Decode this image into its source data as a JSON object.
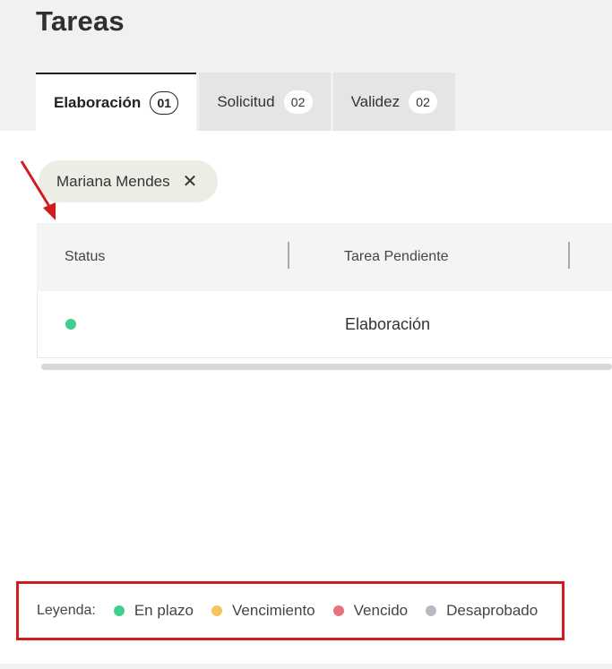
{
  "page": {
    "title": "Tareas"
  },
  "tabs": [
    {
      "label": "Elaboración",
      "count": "01",
      "active": true
    },
    {
      "label": "Solicitud",
      "count": "02",
      "active": false
    },
    {
      "label": "Validez",
      "count": "02",
      "active": false
    }
  ],
  "filter_chip": {
    "label": "Mariana Mendes",
    "close_glyph": "✕"
  },
  "table": {
    "columns": [
      "Status",
      "Tarea Pendiente"
    ],
    "rows": [
      {
        "status": "En plazo",
        "status_color": "#3ecf8e",
        "task": "Elaboración"
      }
    ]
  },
  "legend": {
    "label": "Leyenda:",
    "items": [
      {
        "label": "En plazo",
        "color": "#3ecf8e"
      },
      {
        "label": "Vencimiento",
        "color": "#f5c45e"
      },
      {
        "label": "Vencido",
        "color": "#e4737a"
      },
      {
        "label": "Desaprobado",
        "color": "#b7b9c3"
      }
    ]
  },
  "colors": {
    "highlight": "#d11c20",
    "arrow": "#d11c20"
  }
}
